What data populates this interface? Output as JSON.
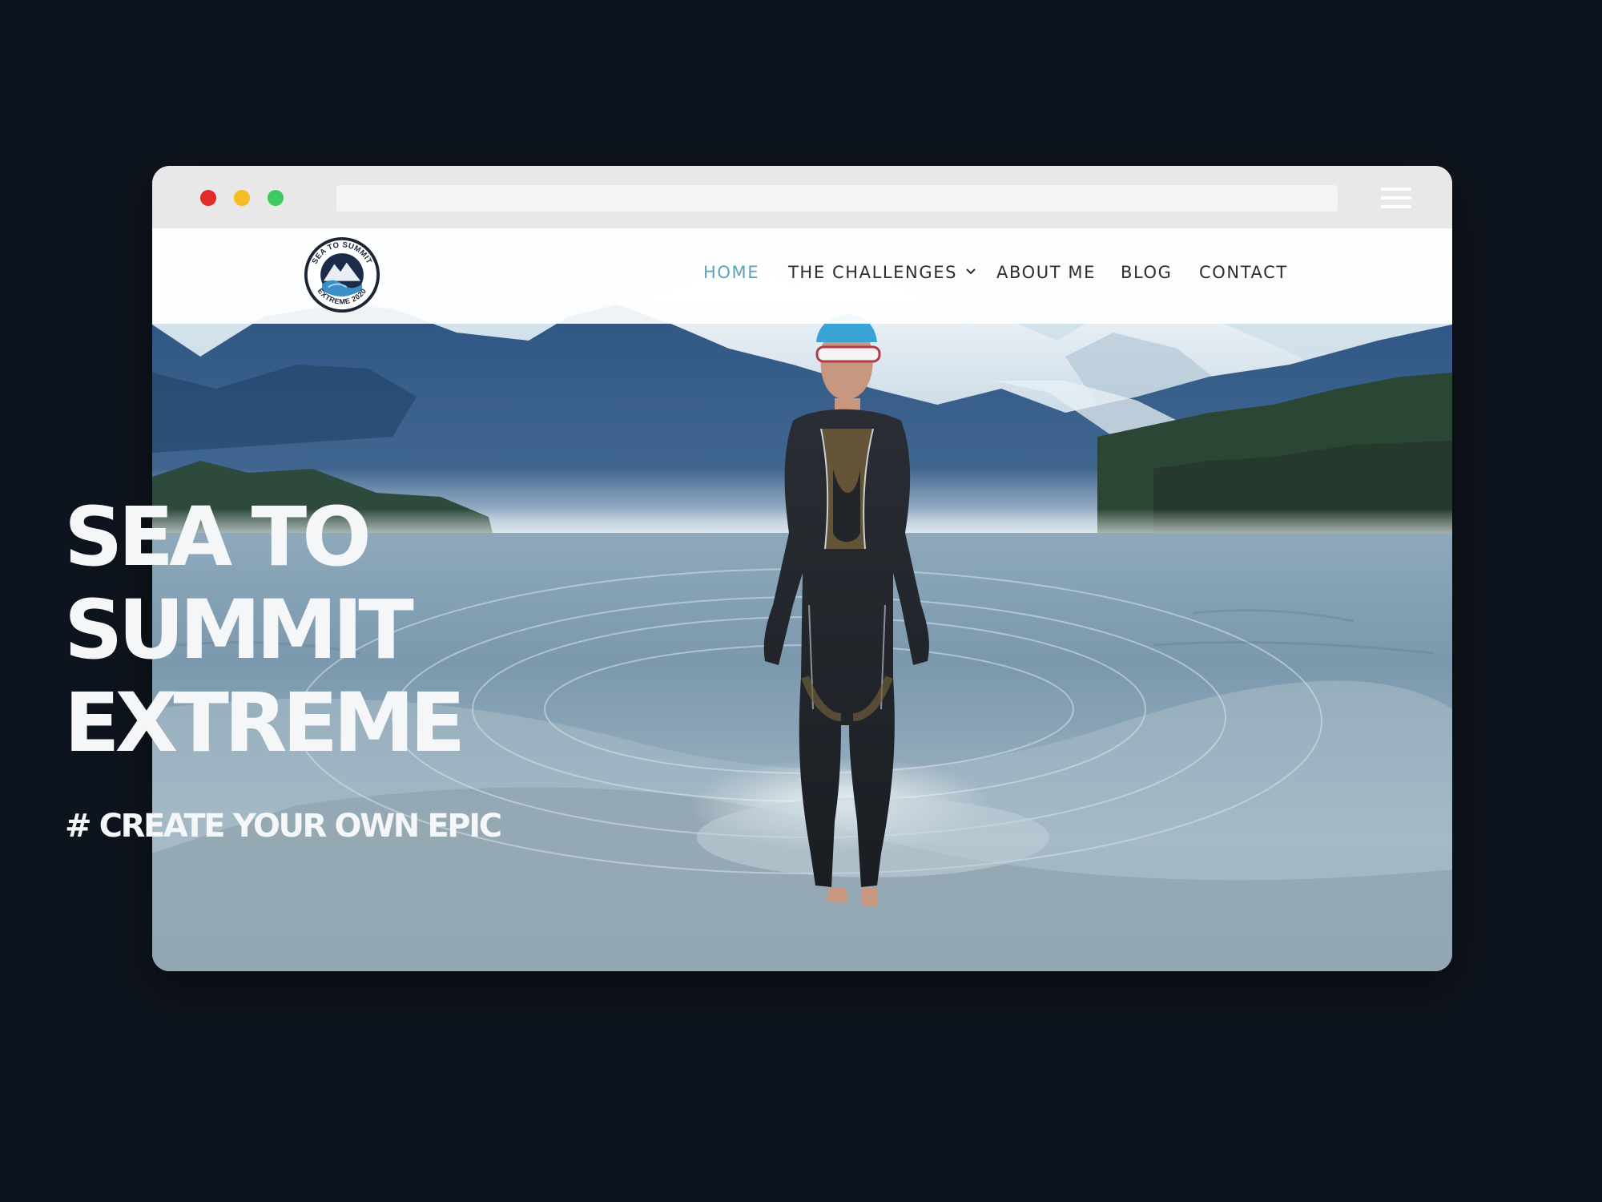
{
  "browser": {
    "address": "",
    "controls": [
      "close",
      "minimize",
      "maximize"
    ],
    "menu_icon": "hamburger-menu-icon"
  },
  "site": {
    "logo_alt": "SEA TO SUMMIT EXTREME 2020",
    "logo_text_top": "SEA TO SUMMIT",
    "logo_text_bottom": "EXTREME 2020"
  },
  "nav": {
    "items": [
      {
        "label": "HOME",
        "active": true
      },
      {
        "label": "THE CHALLENGES",
        "has_dropdown": true
      },
      {
        "label": "ABOUT ME"
      },
      {
        "label": "BLOG"
      },
      {
        "label": "CONTACT"
      }
    ]
  },
  "hero": {
    "title_lines": [
      "SEA TO",
      "SUMMIT",
      "EXTREME"
    ],
    "tagline": "# CREATE YOUR OWN EPIC"
  },
  "colors": {
    "nav_active": "#5fa3b8",
    "nav_text": "#2d2d2d",
    "page_background": "#0e141d",
    "hero_text": "#f4f6f8"
  }
}
